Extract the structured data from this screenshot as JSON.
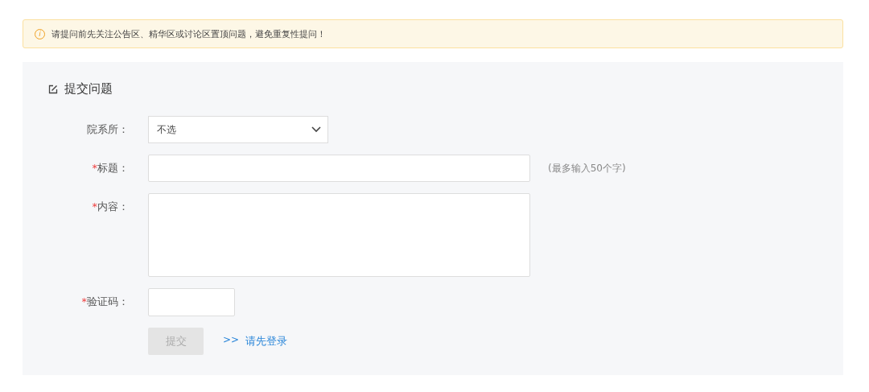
{
  "notice": {
    "icon": "i",
    "text": "请提问前先关注公告区、精华区或讨论区置顶问题，避免重复性提问！"
  },
  "form": {
    "title": "提交问题",
    "fields": [
      {
        "kind": "select",
        "label": "院系所：",
        "value": "不选"
      },
      {
        "kind": "text",
        "mark": "*",
        "label": "标题：",
        "hint": "(最多输入50个字)"
      },
      {
        "kind": "textarea",
        "mark": "*",
        "label": "内容："
      },
      {
        "kind": "captcha",
        "mark": "*",
        "label": "验证码："
      }
    ],
    "submit": {
      "label": "提交",
      "disabled": true
    },
    "login_prefix": ">>",
    "login_link": "请先登录"
  }
}
